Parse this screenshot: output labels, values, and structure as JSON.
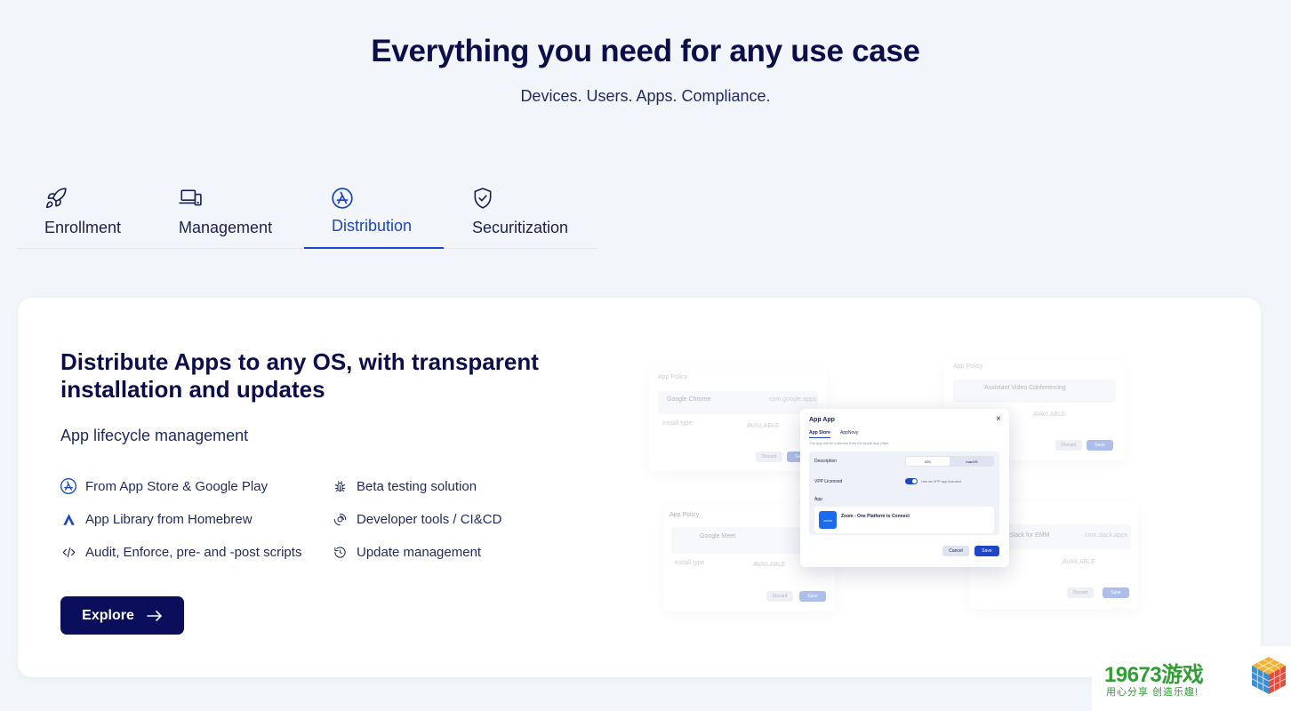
{
  "hero": {
    "title": "Everything you need for any use case",
    "subtitle": "Devices. Users. Apps. Compliance."
  },
  "tabs": [
    {
      "label": "Enrollment",
      "icon": "rocket-icon"
    },
    {
      "label": "Management",
      "icon": "devices-icon"
    },
    {
      "label": "Distribution",
      "icon": "app-store-icon",
      "active": true
    },
    {
      "label": "Securitization",
      "icon": "shield-check-icon"
    }
  ],
  "card": {
    "title": "Distribute Apps to any OS, with transparent installation and updates",
    "subtitle": "App lifecycle management",
    "features_left": [
      {
        "label": "From App Store & Google Play",
        "icon": "app-store-icon"
      },
      {
        "label": "App Library from Homebrew",
        "icon": "homebrew-icon"
      },
      {
        "label": "Audit, Enforce, pre- and -post scripts",
        "icon": "code-icon"
      }
    ],
    "features_right": [
      {
        "label": "Beta testing solution",
        "icon": "bug-icon"
      },
      {
        "label": "Developer tools / CI&CD",
        "icon": "dev-tools-icon"
      },
      {
        "label": "Update management",
        "icon": "update-icon"
      }
    ],
    "explore_label": "Explore"
  },
  "illustration": {
    "policy_label": "App Policy",
    "chrome_name": "Google Chrome",
    "chrome_id": "com.google.apps",
    "conference_name": "Assistant Video Conferencing",
    "meet_name": "Google Meet",
    "slack_name": "Slack for EMM",
    "slack_id": "com.slack.apps",
    "install_type": "Install type",
    "available": "AVAILABLE",
    "discard": "Discard",
    "save": "Save",
    "modal": {
      "title": "App App",
      "tab1": "App Store",
      "tab2": "AppNovy",
      "hint": "The App will be collected from the Apple App Store",
      "description_label": "Description",
      "seg_a": "iOS",
      "seg_b": "macOS",
      "vpp_label": "VPP Licensed",
      "vpp_toggle_label": "Use as VPP app licensed",
      "app_label": "App",
      "app_logo": "zoom",
      "app_name": "Zoom - One Platform to Connect",
      "cancel": "Cancel",
      "save": "Save"
    }
  },
  "watermark": {
    "number": "19673游戏",
    "slogan": "用心分享 创造乐趣!"
  },
  "colors": {
    "navy": "#0b0e4a",
    "accent": "#1b47c8",
    "background": "#f2f5f9",
    "watermark_green": "#2f9e33"
  }
}
